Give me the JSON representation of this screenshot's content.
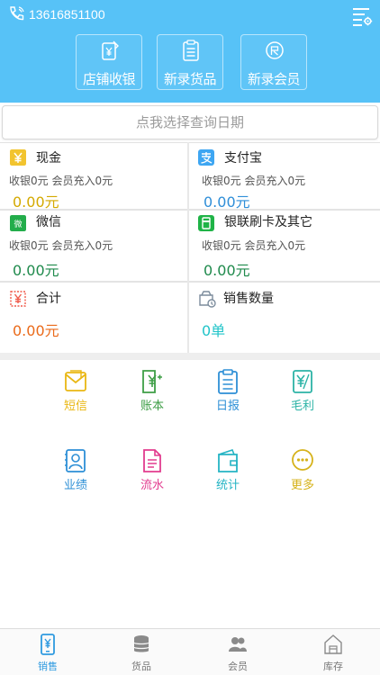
{
  "header": {
    "phone": "13616851100",
    "quick_actions": [
      {
        "label": "店铺收银",
        "icon": "cashier-icon"
      },
      {
        "label": "新录货品",
        "icon": "new-goods-icon"
      },
      {
        "label": "新录会员",
        "icon": "new-member-icon"
      }
    ]
  },
  "date_picker": {
    "label": "点我选择查询日期"
  },
  "payments": [
    {
      "title": "现金",
      "sub": "收银0元 会员充入0元",
      "amount": "0.00元",
      "amount_color": "#d4a900",
      "icon": "cash-icon",
      "icon_color": "#f2c42f"
    },
    {
      "title": "支付宝",
      "sub": "收银0元 会员充入0元",
      "amount": "0.00元",
      "amount_color": "#2f8ed8",
      "icon": "alipay-icon",
      "icon_color": "#3ea6f2"
    },
    {
      "title": "微信",
      "sub": "收银0元 会员充入0元",
      "amount": "0.00元",
      "amount_color": "#1f8a4c",
      "icon": "wechat-icon",
      "icon_color": "#23ad4b"
    },
    {
      "title": "银联刷卡及其它",
      "sub": "收银0元 会员充入0元",
      "amount": "0.00元",
      "amount_color": "#1f8a4c",
      "icon": "unionpay-card-icon",
      "icon_color": "#1fb347"
    },
    {
      "title": "合计",
      "sub": "",
      "amount": "0.00元",
      "amount_color": "#ea6a1a",
      "icon": "total-icon",
      "icon_color": "#f05a4b"
    },
    {
      "title": "销售数量",
      "sub": "",
      "amount": "0单",
      "amount_color": "#21c4c9",
      "icon": "sales-count-icon",
      "icon_color": "#7c8c9c"
    }
  ],
  "features": [
    {
      "label": "短信",
      "color": "#e9b713",
      "icon": "sms-icon"
    },
    {
      "label": "账本",
      "color": "#3e9e46",
      "icon": "ledger-icon"
    },
    {
      "label": "日报",
      "color": "#2d8fd6",
      "icon": "daily-report-icon"
    },
    {
      "label": "毛利",
      "color": "#2cb3a6",
      "icon": "gross-profit-icon"
    },
    {
      "label": "业绩",
      "color": "#2d8fd6",
      "icon": "performance-icon"
    },
    {
      "label": "流水",
      "color": "#e23c8f",
      "icon": "flow-icon"
    },
    {
      "label": "统计",
      "color": "#25b4c4",
      "icon": "statistics-icon"
    },
    {
      "label": "更多",
      "color": "#d6b21a",
      "icon": "more-icon"
    }
  ],
  "bottom_nav": [
    {
      "label": "销售",
      "active": true,
      "icon": "sales-phone-icon"
    },
    {
      "label": "货品",
      "active": false,
      "icon": "goods-stack-icon"
    },
    {
      "label": "会员",
      "active": false,
      "icon": "members-icon"
    },
    {
      "label": "库存",
      "active": false,
      "icon": "warehouse-icon"
    }
  ]
}
